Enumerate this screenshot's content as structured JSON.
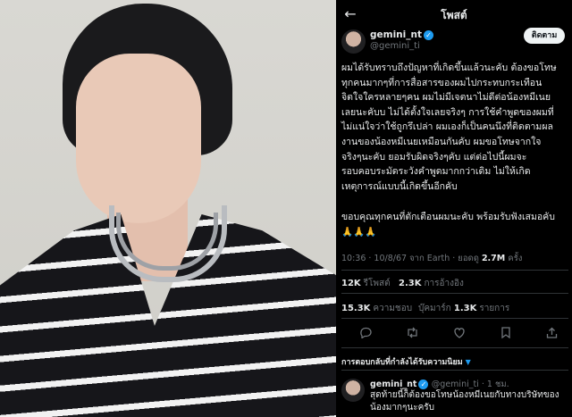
{
  "post_header": {
    "title": "โพสต์",
    "follow_label": "ติดตาม"
  },
  "author": {
    "name": "gemini_nt",
    "handle": "@gemini_ti"
  },
  "post": {
    "lines_p1": [
      "ผมได้รับทราบถึงปัญหาที่เกิดขึ้นแล้วนะคับ ต้องขอโทษ",
      "ทุกคนมากๆที่การสื่อสารของผมไปกระทบกระเทือน",
      "จิตใจใครหลายๆคน ผมไม่มีเจตนาไม่ดีต่อน้องหมีเนย",
      "เลยนะคับบ ไม่ได้ตั้งใจเลยจริงๆ การใช้คำพูดของผมที่",
      "ไม่แน่ใจว่าใช้ถูกรึเปล่า ผมเองก็เป็นคนนึงที่ติดตามผล",
      "งานของน้องหมีเนยเหมือนกันคับ ผมขอโทษจากใจ",
      "จริงๆนะคับ ยอมรับผิดจริงๆคับ แต่ต่อไปนี้ผมจะ",
      "รอบคอบระมัดระวังคำพูดมากกว่าเดิม ไม่ให้เกิด",
      "เหตุการณ์แบบนี้เกิดขึ้นอีกคับ"
    ],
    "line_p2": "ขอบคุณทุกคนที่ตักเตือนผมนะคับ พร้อมรับฟังเสมอคับ",
    "emoji": "🙏🙏🙏"
  },
  "meta": {
    "time": "10:36 · 10/8/67 จาก Earth · ยอดดู",
    "views": "2.7M",
    "views_label": "ครั้ง"
  },
  "stats": {
    "reposts": "12K",
    "reposts_label": "รีโพสต์",
    "quotes": "2.3K",
    "quotes_label": "การอ้างอิง",
    "likes": "15.3K",
    "likes_label": "ความชอบ",
    "bookmarks_label": "บุ๊คมาร์ก",
    "bookmarks": "1.3K",
    "bookmarks_unit": "รายการ"
  },
  "icons": [
    "reply-icon",
    "repost-icon",
    "like-icon",
    "bookmark-icon",
    "share-icon"
  ],
  "sort_label": "การตอบกลับที่กำลังได้รับความนิยม",
  "reply": {
    "name": "gemini_nt",
    "handle_time": "@gemini_ti · 1 ชม.",
    "text": "สุดท้ายนี้ก็ต้องขอโทษน้องหมีเนยกับทางบริษัทของน้องมากๆนะครับ"
  },
  "colors": {
    "accent": "#1d9bf0",
    "background": "#000000",
    "muted": "#71767b"
  }
}
